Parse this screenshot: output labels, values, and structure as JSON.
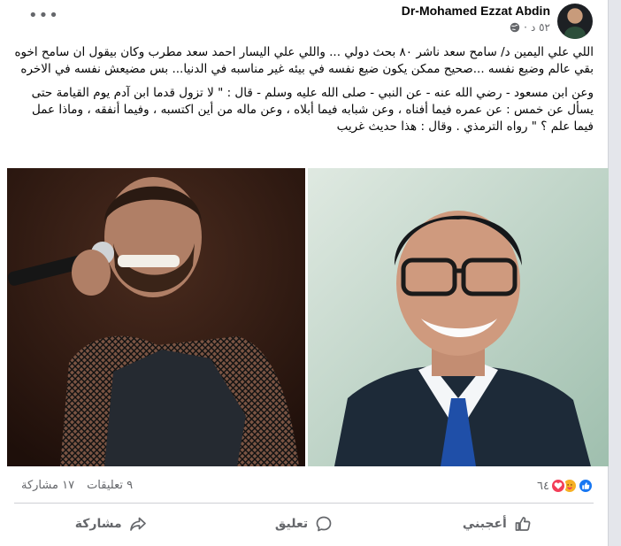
{
  "post": {
    "author": "Dr-Mohamed Ezzat Abdin",
    "time": "٥٢ د",
    "paragraphs": [
      "اللي علي اليمين د/ سامح سعد ناشر ٨٠ بحث دولي ... واللي علي اليسار احمد سعد مطرب وكان بيقول ان سامح اخوه بقي عالم وضيع نفسه ...صحيح ممكن يكون ضيع نفسه في بيئه غير مناسبه في الدنيا... بس مضيعش نفسه في الاخره",
      "وعن ابن مسعود - رضي الله عنه - عن النبي - صلى الله عليه وسلم - قال : \" لا تزول قدما ابن آدم يوم القيامة حتى يسأل عن خمس : عن عمره فيما أفناه ، وعن شبابه فيما أبلاه ، وعن ماله من أين اكتسبه ، وفيما أنفقه ، وماذا عمل فيما علم ؟ \" رواه الترمذي . وقال : هذا حديث غريب"
    ]
  },
  "stats": {
    "reaction_count": "٦٤",
    "comments": "٩ تعليقات",
    "shares": "١٧ مشاركة"
  },
  "actions": {
    "like": "أعجبني",
    "comment": "تعليق",
    "share": "مشاركة"
  },
  "icons": {
    "privacy": "globe-icon",
    "menu": "more-icon",
    "reactions": [
      "like-reaction-icon",
      "care-reaction-icon",
      "love-reaction-icon"
    ]
  },
  "colors": {
    "like_blue": "#1877f2",
    "love_red": "#f33e58",
    "care_yellow": "#f7b125",
    "secondary_text": "#65676b"
  }
}
